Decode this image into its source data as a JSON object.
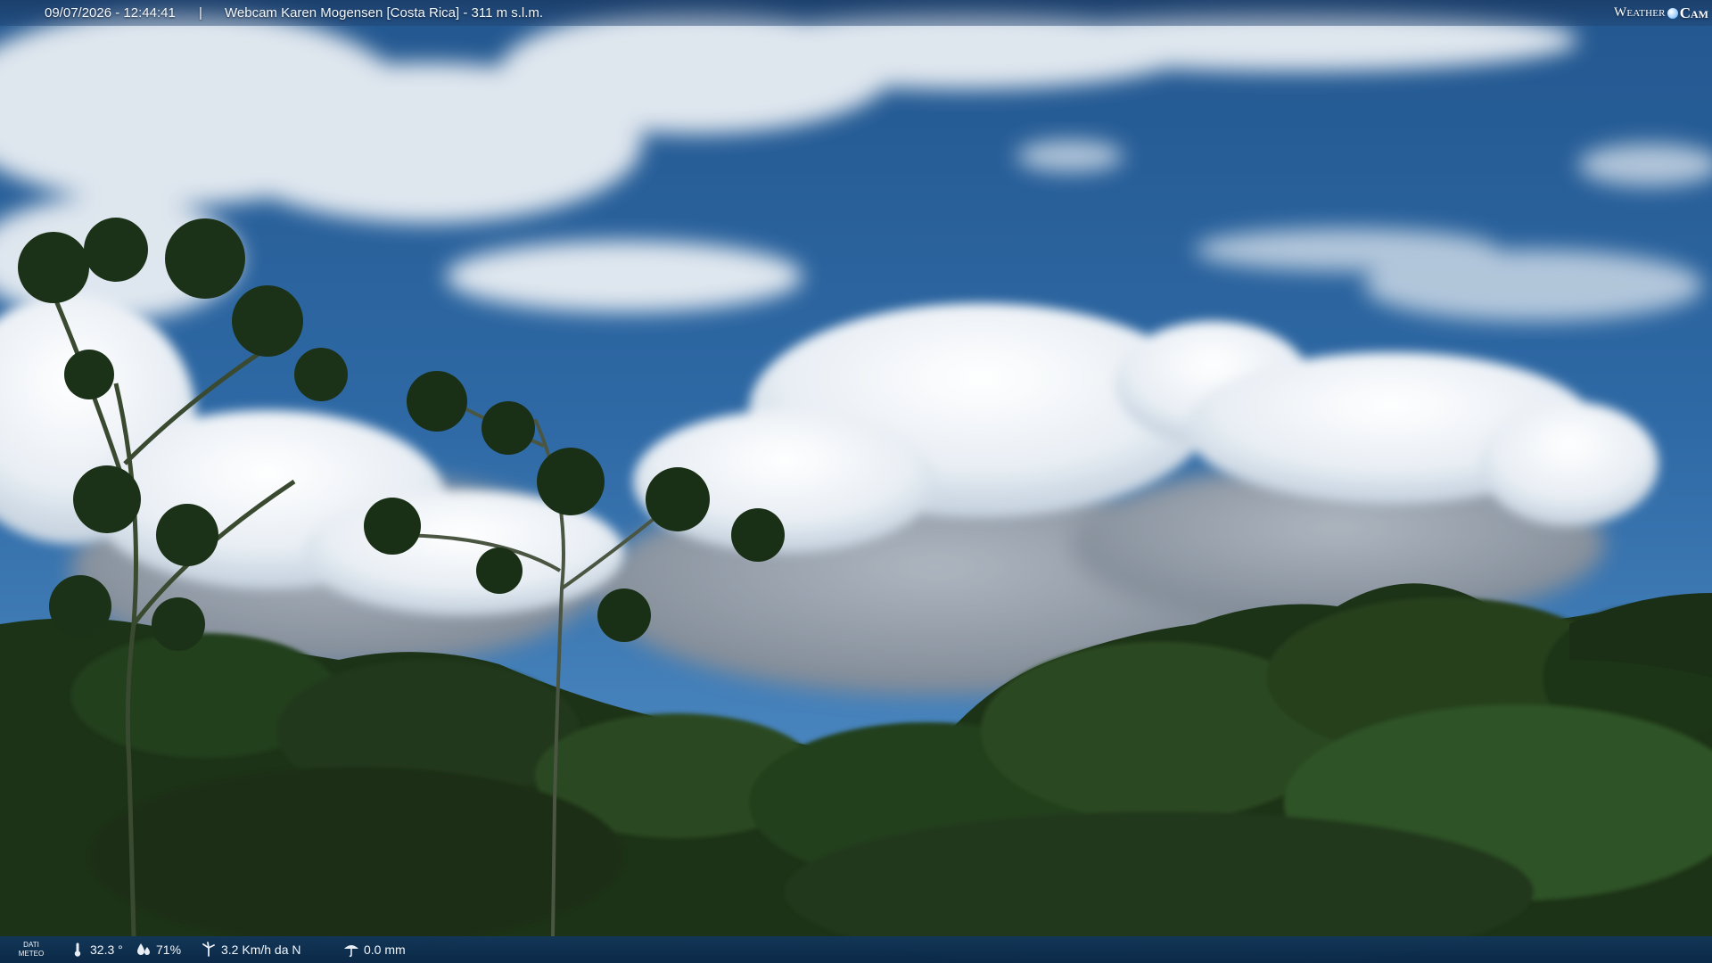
{
  "overlay": {
    "timestamp": "09/07/2026 - 12:44:41",
    "separator": "|",
    "camera_name": "Webcam Karen Mogensen [Costa Rica]  - 311 m s.l.m.",
    "logo_word": "Weather",
    "logo_cam": "Cam"
  },
  "meteo": {
    "label_line1": "DATI",
    "label_line2": "METEO",
    "temperature": "32.3 °",
    "humidity": "71%",
    "wind": "3.2 Km/h da N",
    "rain": "0.0 mm"
  },
  "icons": {
    "temperature": "thermometer-icon",
    "humidity": "humidity-icon",
    "wind": "wind-icon",
    "rain": "rain-gauge-icon"
  },
  "colors": {
    "sky": "#2f6aa6",
    "bar": "#123a66",
    "foliage": "#1e3318"
  }
}
